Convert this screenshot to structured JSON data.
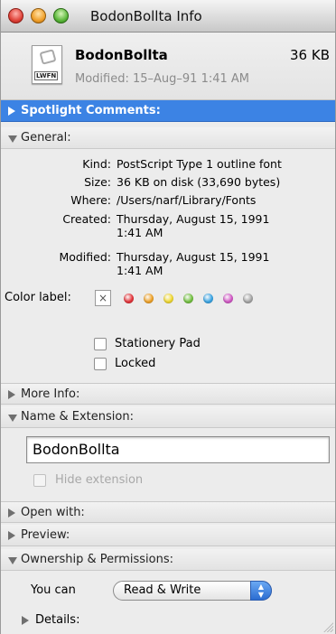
{
  "window": {
    "title": "BodonBollta Info"
  },
  "header": {
    "file_name": "BodonBollta",
    "file_size": "36 KB",
    "modified": "Modified: 15–Aug–91 1:41 AM",
    "icon_tag": "LWFN",
    "icon": "font-file-icon"
  },
  "sections": {
    "spotlight": "Spotlight Comments:",
    "general": "General:",
    "more_info": "More Info:",
    "name_ext": "Name & Extension:",
    "open_with": "Open with:",
    "preview": "Preview:",
    "ownership": "Ownership & Permissions:"
  },
  "general": {
    "kind_label": "Kind:",
    "kind": "PostScript Type 1 outline font",
    "size_label": "Size:",
    "size": "36 KB on disk (33,690 bytes)",
    "where_label": "Where:",
    "where": "/Users/narf/Library/Fonts",
    "created_label": "Created:",
    "created_1": "Thursday, August 15, 1991",
    "created_2": "1:41 AM",
    "modified_label": "Modified:",
    "modified_1": "Thursday, August 15, 1991",
    "modified_2": "1:41 AM",
    "color_label": "Color label:",
    "color_none": "×",
    "colors": [
      "#e8363c",
      "#f2a52a",
      "#f4dc34",
      "#76c443",
      "#3da8e8",
      "#d55bc9",
      "#a8a8a8"
    ],
    "stationery": "Stationery Pad",
    "locked": "Locked"
  },
  "name_ext": {
    "value": "BodonBollta",
    "hide_ext": "Hide extension"
  },
  "ownership": {
    "you_can_label": "You can",
    "you_can_value": "Read & Write",
    "details": "Details:"
  },
  "colors": {
    "accent": "#3c83e4",
    "window_bg": "#ececec"
  }
}
